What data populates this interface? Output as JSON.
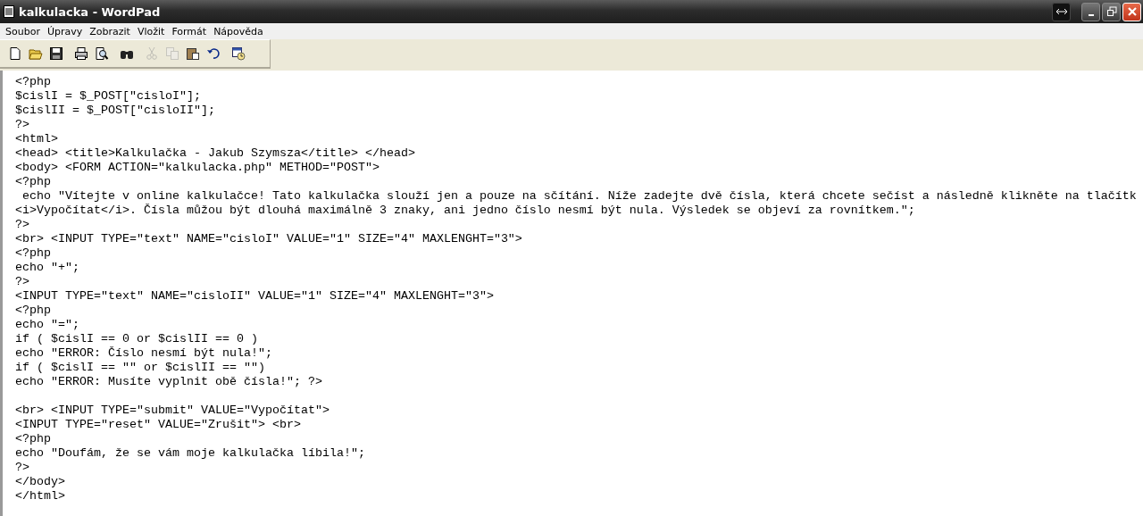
{
  "window": {
    "title": "kalkulacka - WordPad"
  },
  "menu": [
    "Soubor",
    "Úpravy",
    "Zobrazit",
    "Vložit",
    "Formát",
    "Nápověda"
  ],
  "toolbar": [
    [
      {
        "kind": "new",
        "disabled": false
      },
      {
        "kind": "open",
        "disabled": false
      },
      {
        "kind": "save",
        "disabled": false
      }
    ],
    [
      {
        "kind": "print",
        "disabled": false
      },
      {
        "kind": "preview",
        "disabled": false
      }
    ],
    [
      {
        "kind": "find",
        "disabled": false
      }
    ],
    [
      {
        "kind": "cut",
        "disabled": true
      },
      {
        "kind": "copy",
        "disabled": true
      },
      {
        "kind": "paste",
        "disabled": false
      },
      {
        "kind": "undo",
        "disabled": false
      }
    ],
    [
      {
        "kind": "datetime",
        "disabled": false
      }
    ]
  ],
  "document": [
    [
      "<?php",
      "$cislI = $_POST[\"cisloI\"];",
      "$cislII = $_POST[\"cisloII\"];",
      "?>",
      "<html>",
      "<head> <title>Kalkulačka - Jakub Szymsza</title> </head>",
      "<body> <FORM ACTION=\"kalkulacka.php\" METHOD=\"POST\">",
      "<?php",
      " echo \"Vítejte v online kalkulačce! Tato kalkulačka slouží jen a pouze na sčítání. Níže zadejte dvě čísla, která chcete sečíst a následně klikněte na tlačítk",
      "<i>Vypočítat</i>. Čísla můžou být dlouhá maximálně 3 znaky, ani jedno číslo nesmí být nula. Výsledek se objeví za rovnítkem.\";",
      "?>",
      "<br> <INPUT TYPE=\"text\" NAME=\"cisloI\" VALUE=\"1\" SIZE=\"4\" MAXLENGHT=\"3\">",
      "<?php",
      "echo \"+\";",
      "?>",
      "<INPUT TYPE=\"text\" NAME=\"cisloII\" VALUE=\"1\" SIZE=\"4\" MAXLENGHT=\"3\">",
      "<?php",
      "echo \"=\";",
      "if ( $cislI == 0 or $cislII == 0 )",
      "echo \"ERROR: Číslo nesmí být nula!\";",
      "if ( $cislI == \"\" or $cislII == \"\")",
      "echo \"ERROR: Musíte vyplnit obě čísla!\"; ?>"
    ],
    [
      "<br> <INPUT TYPE=\"submit\" VALUE=\"Vypočítat\">",
      "<INPUT TYPE=\"reset\" VALUE=\"Zrušit\"> <br>",
      "<?php",
      "echo \"Doufám, že se vám moje kalkulačka líbila!\";",
      "?>",
      "</body>",
      "</html>"
    ]
  ]
}
